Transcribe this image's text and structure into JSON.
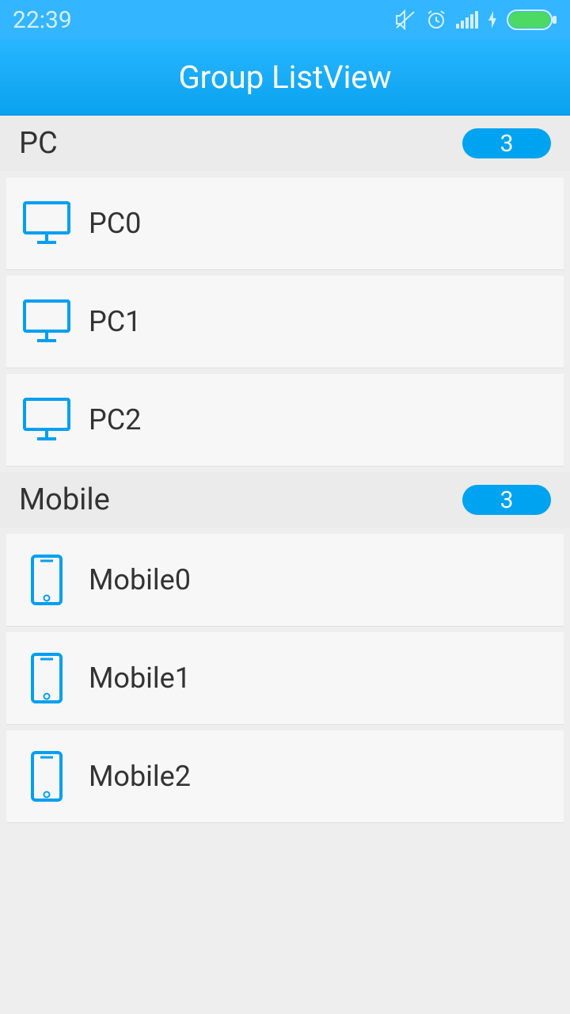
{
  "status": {
    "time": "22:39"
  },
  "app": {
    "title": "Group ListView"
  },
  "groups": [
    {
      "name": "PC",
      "count": "3",
      "icon": "monitor",
      "items": [
        {
          "label": "PC0"
        },
        {
          "label": "PC1"
        },
        {
          "label": "PC2"
        }
      ]
    },
    {
      "name": "Mobile",
      "count": "3",
      "icon": "phone",
      "items": [
        {
          "label": "Mobile0"
        },
        {
          "label": "Mobile1"
        },
        {
          "label": "Mobile2"
        }
      ]
    }
  ],
  "colors": {
    "accent": "#00a3f0",
    "status": "#33b5ff",
    "battery": "#4cd964"
  }
}
